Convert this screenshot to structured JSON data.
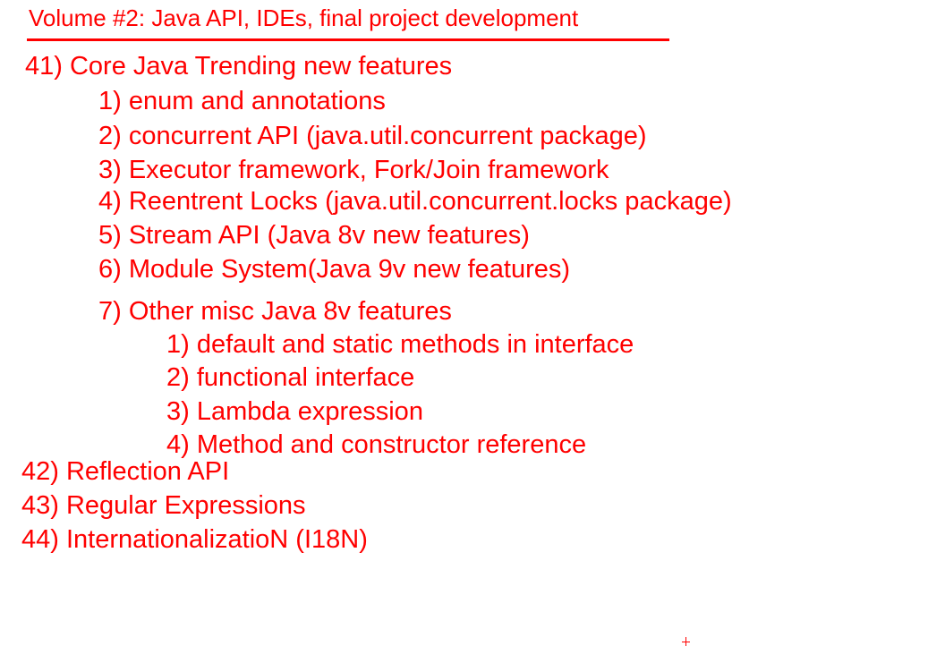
{
  "title": "Volume #2: Java API, IDEs, final project development",
  "colors": {
    "text": "#ff0000",
    "background": "#ffffff"
  },
  "lines": [
    "41) Core Java Trending new features",
    "1) enum and annotations",
    "2) concurrent API (java.util.concurrent package)",
    "3) Executor framework, Fork/Join framework",
    "4) Reentrent Locks (java.util.concurrent.locks package)",
    "5) Stream API (Java 8v new features)",
    "6) Module System(Java 9v new features)",
    "7) Other misc Java 8v features",
    "1) default and static methods in interface",
    "2) functional interface",
    "3) Lambda expression",
    "4) Method and constructor reference",
    "42) Reflection API",
    "43) Regular Expressions",
    "44) InternationalizatioN (I18N)"
  ]
}
